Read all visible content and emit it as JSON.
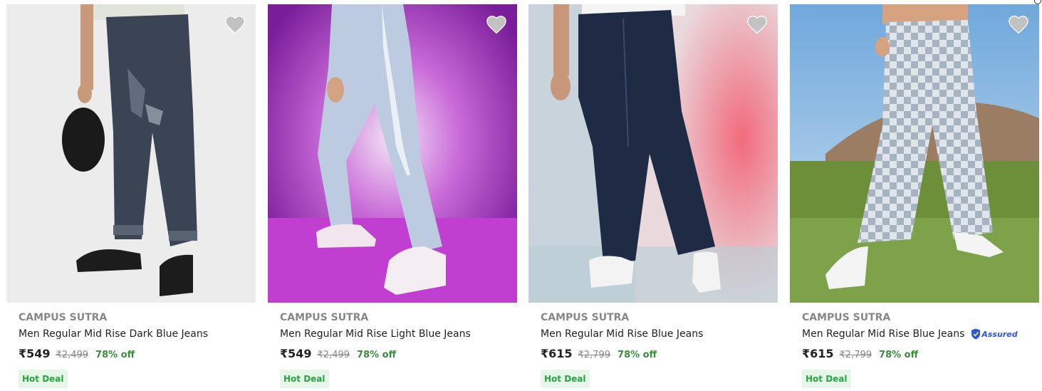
{
  "products": [
    {
      "brand": "CAMPUS SUTRA",
      "title": "Men Regular Mid Rise Dark Blue Jeans",
      "price": "₹549",
      "mrp": "₹2,499",
      "discount": "78% off",
      "badge": "Hot Deal",
      "assured": false,
      "image_icon": "dark-blue-jeans-photo"
    },
    {
      "brand": "CAMPUS SUTRA",
      "title": "Men Regular Mid Rise Light Blue Jeans",
      "price": "₹549",
      "mrp": "₹2,499",
      "discount": "78% off",
      "badge": "Hot Deal",
      "assured": false,
      "image_icon": "light-blue-jeans-photo"
    },
    {
      "brand": "CAMPUS SUTRA",
      "title": "Men Regular Mid Rise Blue Jeans",
      "price": "₹615",
      "mrp": "₹2,799",
      "discount": "78% off",
      "badge": "Hot Deal",
      "assured": false,
      "image_icon": "blue-jeans-photo"
    },
    {
      "brand": "CAMPUS SUTRA",
      "title": "Men Regular Mid Rise Blue Jeans",
      "price": "₹615",
      "mrp": "₹2,799",
      "discount": "78% off",
      "badge": "Hot Deal",
      "assured": true,
      "assured_label": "Assured",
      "image_icon": "checkered-jeans-photo"
    }
  ],
  "colors": {
    "brand_text": "#878787",
    "title_text": "#212121",
    "discount_green": "#388e3c",
    "deal_bg": "#e6f7ea",
    "deal_text": "#26a541",
    "assured_blue": "#2a55e5",
    "heart_grey": "#c2c2c2"
  },
  "icons": {
    "wishlist": "heart-icon",
    "assured": "assured-shield-icon"
  }
}
